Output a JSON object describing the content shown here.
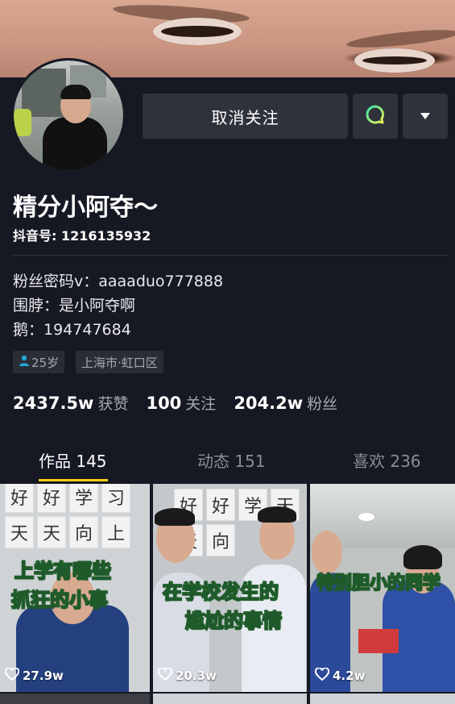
{
  "profile": {
    "nickname": "精分小阿夺～",
    "douyin_id": "抖音号: 1216135932",
    "bio": [
      "粉丝密码v：aaaaduo777888",
      "围脖：是小阿夺啊",
      "鹅：194747684"
    ],
    "tags": {
      "age": "25岁",
      "location": "上海市·虹口区"
    },
    "stats": [
      {
        "num": "2437.5w",
        "label": "获赞"
      },
      {
        "num": "100",
        "label": "关注"
      },
      {
        "num": "204.2w",
        "label": "粉丝"
      }
    ]
  },
  "actions": {
    "unfollow_label": "取消关注",
    "message_icon": "chat-bubble-icon",
    "more_icon": "caret-down-icon"
  },
  "tabs": [
    {
      "label": "作品 145",
      "active": true
    },
    {
      "label": "动态 151",
      "active": false
    },
    {
      "label": "喜欢 236",
      "active": false
    }
  ],
  "videos": [
    {
      "caption_line1": "上学有哪些",
      "caption_line2": "抓狂的小事",
      "likes": "27.9w",
      "board": [
        "好",
        "好",
        "学",
        "习",
        "天",
        "天",
        "向",
        "上"
      ]
    },
    {
      "caption_line1": "在学校发生的",
      "caption_line2": "尴尬的事情",
      "likes": "20.3w",
      "board": [
        "好",
        "好",
        "学",
        "天",
        "天",
        "向"
      ]
    },
    {
      "caption_line1": "特别胆小的同学",
      "caption_line2": "",
      "likes": "4.2w"
    }
  ],
  "colors": {
    "background": "#161823",
    "accent": "#face15",
    "button": "#2f313b",
    "caption": "#ffe426"
  }
}
